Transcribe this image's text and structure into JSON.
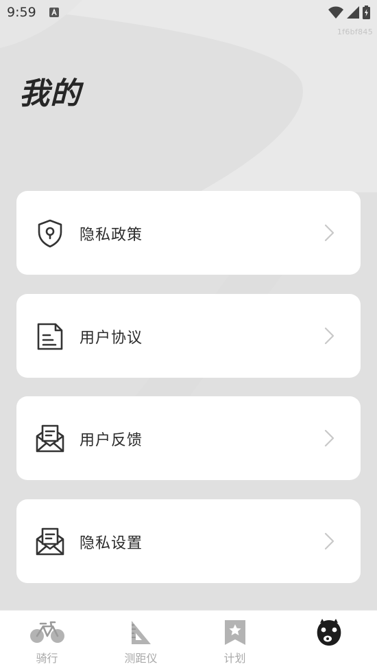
{
  "status": {
    "time": "9:59"
  },
  "build_id": "1f6bf845",
  "page": {
    "title": "我的"
  },
  "menu": [
    {
      "label": "隐私政策",
      "icon": "shield-lock-icon"
    },
    {
      "label": "用户协议",
      "icon": "document-icon"
    },
    {
      "label": "用户反馈",
      "icon": "envelope-letter-icon"
    },
    {
      "label": "隐私设置",
      "icon": "envelope-letter-icon"
    }
  ],
  "tabs": [
    {
      "label": "骑行",
      "icon": "bicycle-icon",
      "active": false
    },
    {
      "label": "测距仪",
      "icon": "set-square-icon",
      "active": false
    },
    {
      "label": "计划",
      "icon": "bookmark-star-icon",
      "active": false
    },
    {
      "label": "",
      "icon": "mascot-face-icon",
      "active": true
    }
  ],
  "colors": {
    "background": "#e2e2e2",
    "card": "#ffffff",
    "text": "#2b2b2b",
    "tab_inactive": "#a9a9a9"
  }
}
